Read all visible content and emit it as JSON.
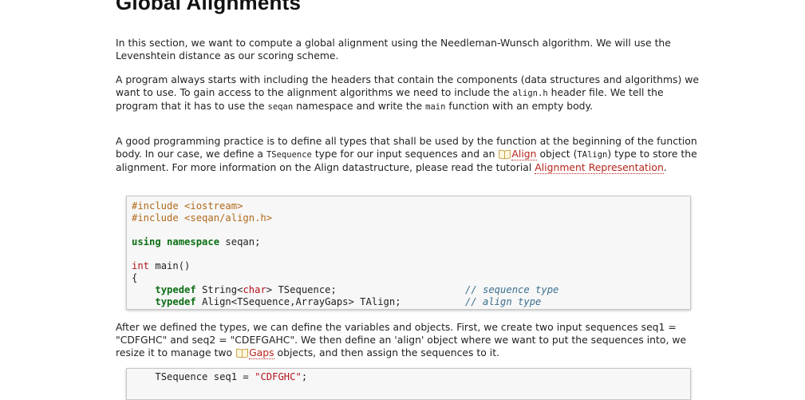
{
  "heading": "Global Alignments",
  "para1": "In this section, we want to compute a global alignment using the Needleman-Wunsch algorithm. We will use the Levenshtein distance as our scoring scheme.",
  "para2": {
    "t1": "A program always starts with including the headers that contain the components (data structures and algorithms) we want to use. To gain access to the alignment algorithms we need to include the ",
    "c1": "align.h",
    "t2": " header file. We tell the program that it has to use the ",
    "c2": "seqan",
    "t3": " namespace and write the ",
    "c3": "main",
    "t4": " function with an empty body."
  },
  "para3": {
    "t1": "A good programming practice is to define all types that shall be used by the function at the beginning of the function body. In our case, we define a ",
    "c1": "TSequence",
    "t2": " type for our input sequences and an ",
    "link1": "Align",
    "t3": " object (",
    "c2": "TAlign",
    "t4": ") type to store the alignment. For more information on the Align datastructure, please read the tutorial ",
    "link2": "Alignment Representation",
    "t5": "."
  },
  "code1": {
    "inc1": "#include <iostream>",
    "inc2": "#include <seqan/align.h>",
    "using_kw": "using namespace",
    "using_rest": " seqan;",
    "int_kw": "int",
    "main_rest": " main()",
    "brace": "{",
    "td_kw": "typedef",
    "l1_a": " String<",
    "l1_char": "char",
    "l1_b": "> TSequence;",
    "l1_comment": "// sequence type",
    "l2_rest": " Align<TSequence,ArrayGaps> TAlign;",
    "l2_comment": "// align type"
  },
  "para4": {
    "t1": "After we defined the types, we can define the variables and objects. First, we create two input sequences seq1 = \"CDFGHC\" and seq2 = \"CDEFGAHC\". We then define an 'align' object where we want to put the sequences into, we resize it to manage two ",
    "link1": "Gaps",
    "t2": " objects, and then assign the sequences to it."
  },
  "code2": {
    "type": "TSequence",
    "var": " seq1 = ",
    "str": "\"CDFGHC\"",
    "end": ";"
  }
}
